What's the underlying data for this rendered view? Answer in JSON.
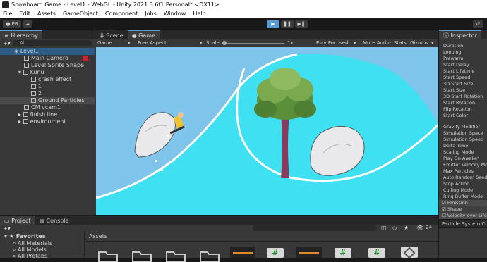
{
  "window": {
    "title": "Snowboard Game - Level1 - WebGL - Unity 2021.3.6f1 Personal* <DX11>"
  },
  "menu": [
    "File",
    "Edit",
    "Assets",
    "GameObject",
    "Component",
    "Jobs",
    "Window",
    "Help"
  ],
  "toolbar": {
    "account": "PB",
    "search_placeholder": "All"
  },
  "hierarchy": {
    "tab": "Hierarchy",
    "search_placeholder": "All",
    "items": [
      {
        "label": "Level1"
      },
      {
        "label": "Main Camera"
      },
      {
        "label": "Level Sprite Shape"
      },
      {
        "label": "Kunu"
      },
      {
        "label": "crash effect"
      },
      {
        "label": "1"
      },
      {
        "label": "2"
      },
      {
        "label": "Ground Particles"
      },
      {
        "label": "CM vcam1"
      },
      {
        "label": "finish line"
      },
      {
        "label": "environment"
      }
    ]
  },
  "scene": {
    "tabs": [
      "Scene",
      "Game"
    ],
    "game_bar": {
      "display": "Game",
      "aspect": "Free Aspect",
      "scale_label": "Scale",
      "scale_value": "1x",
      "play_mode": "Play Focused",
      "mute": "Mute Audio",
      "stats": "Stats",
      "gizmos": "Gizmos"
    }
  },
  "inspector": {
    "tab": "Inspector",
    "rows": [
      "Duration",
      "Looping",
      "Prewarm",
      "Start Delay",
      "Start Lifetime",
      "Start Speed",
      "3D Start Size",
      "Start Size",
      "3D Start Rotation",
      "Start Rotation",
      "Flip Rotation",
      "Start Color",
      "Gravity Modifier",
      "Simulation Space",
      "Simulation Speed",
      "Delta Time",
      "Scaling Mode",
      "Play On Awake*",
      "Emitter Velocity Mode",
      "Max Particles",
      "Auto Random Seed",
      "Stop Action",
      "Culling Mode",
      "Ring Buffer Mode"
    ],
    "modules": [
      "Emission",
      "Shape",
      "Velocity over Lifetime"
    ],
    "footer": "Particle System Curves"
  },
  "project": {
    "tabs": [
      "Project",
      "Console"
    ],
    "favorites_label": "Favorites",
    "favorites": [
      "All Materials",
      "All Models",
      "All Prefabs"
    ],
    "assets_label": "Assets",
    "item_count": "24"
  },
  "colors": {
    "sky": "#7fc4ea",
    "ground": "#3ee0f2",
    "accent": "#5a9bd5"
  }
}
